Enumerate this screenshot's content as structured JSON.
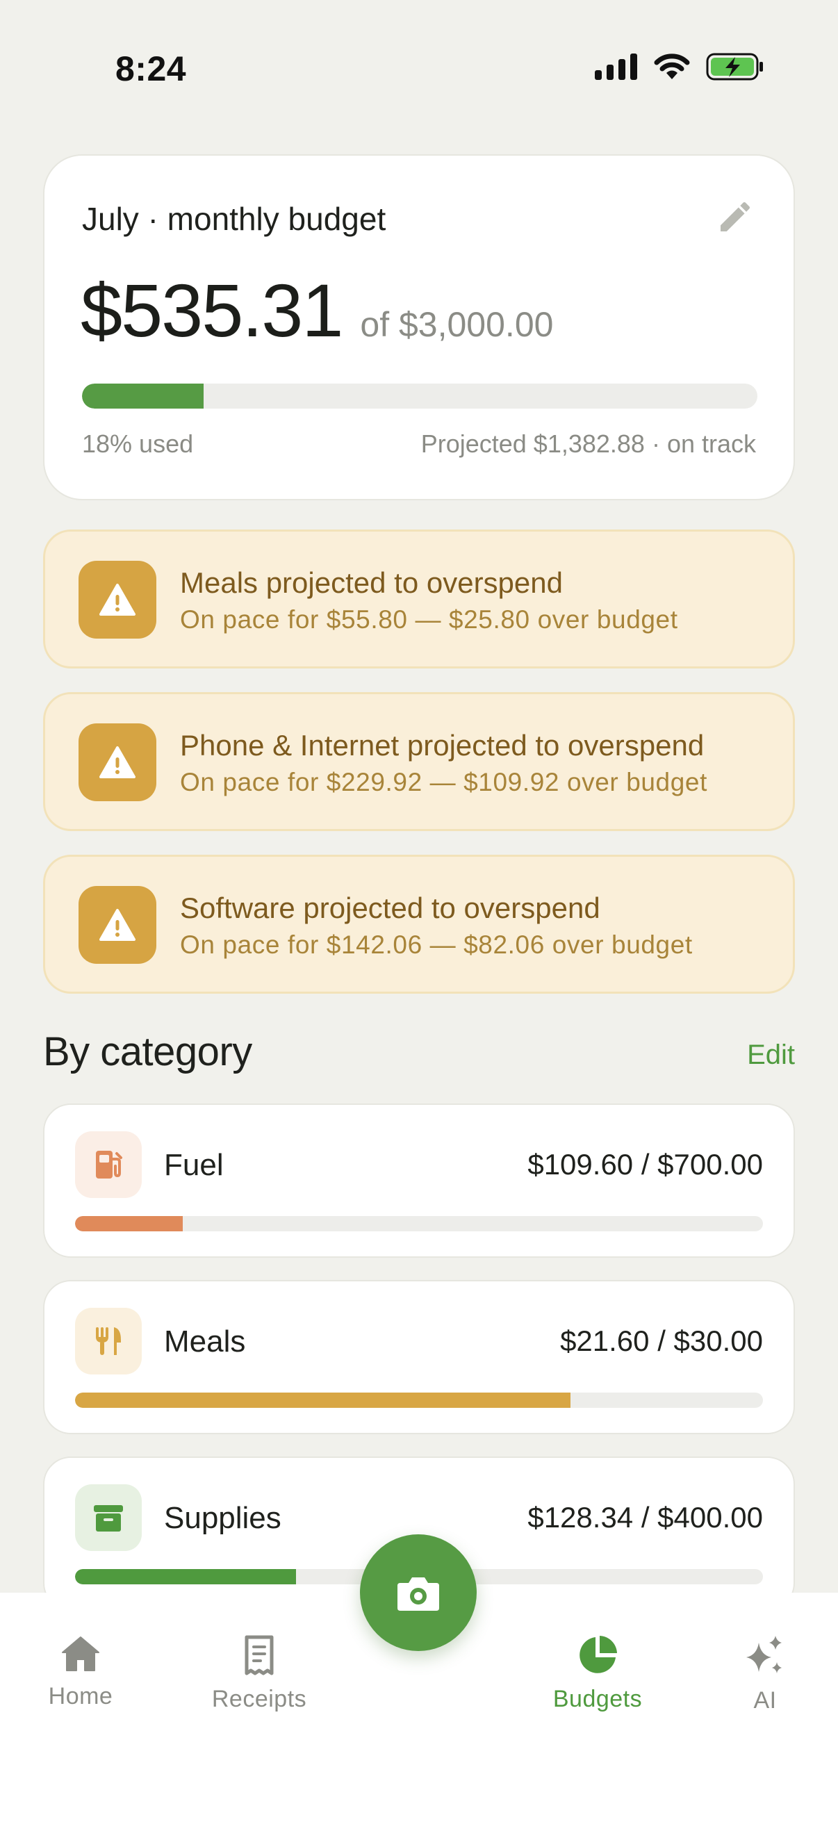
{
  "status_bar": {
    "time": "8:24"
  },
  "budget": {
    "title": "July · monthly budget",
    "spent": "$535.31",
    "of_total": "of $3,000.00",
    "used_fraction": 0.18,
    "used_label": "18% used",
    "projected_label": "Projected $1,382.88 · on track",
    "accent": "#569b44"
  },
  "alerts": [
    {
      "title": "Meals projected to overspend",
      "subtitle": "On pace for $55.80 — $25.80 over budget"
    },
    {
      "title": "Phone & Internet projected to overspend",
      "subtitle": "On pace for $229.92 — $109.92 over budget"
    },
    {
      "title": "Software projected to overspend",
      "subtitle": "On pace for $142.06 — $82.06 over budget"
    }
  ],
  "categories_section": {
    "title": "By category",
    "edit_label": "Edit"
  },
  "categories": [
    {
      "name": "Fuel",
      "amount": "$109.60 / $700.00",
      "fraction": 0.157,
      "icon": "fuel-pump-icon",
      "color": "#e08a5a",
      "icon_bg": "#fbeee6"
    },
    {
      "name": "Meals",
      "amount": "$21.60 / $30.00",
      "fraction": 0.72,
      "icon": "fork-knife-icon",
      "color": "#d8a644",
      "icon_bg": "#faf0de"
    },
    {
      "name": "Supplies",
      "amount": "$128.34 / $400.00",
      "fraction": 0.321,
      "icon": "archive-box-icon",
      "color": "#4f9a3e",
      "icon_bg": "#e7f1e2"
    }
  ],
  "nav": {
    "home": "Home",
    "receipts": "Receipts",
    "budgets": "Budgets",
    "ai": "AI",
    "active": "budgets",
    "active_color": "#4f9a3e"
  }
}
